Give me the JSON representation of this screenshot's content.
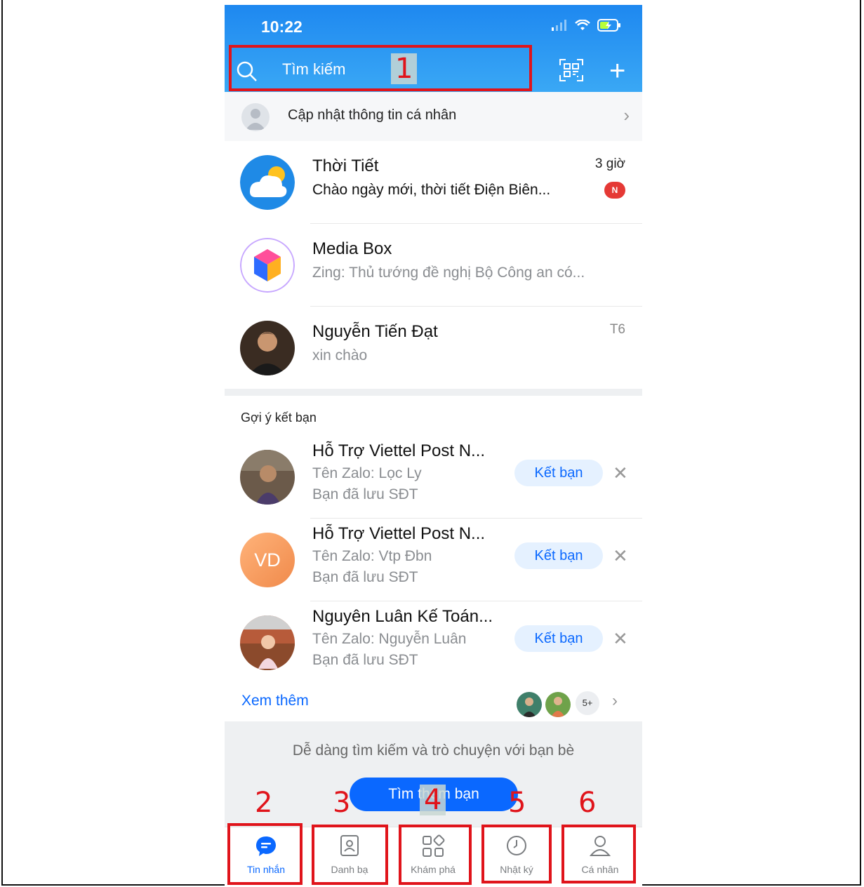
{
  "status_bar": {
    "time": "10:22"
  },
  "search": {
    "placeholder": "Tìm kiếm"
  },
  "update_profile": {
    "label": "Cập nhật thông tin cá nhân"
  },
  "chats": [
    {
      "name": "Thời Tiết",
      "message": "Chào ngày mới, thời tiết Điện Biên...",
      "time": "3 giờ",
      "badge": "N"
    },
    {
      "name": "Media Box",
      "message": "Zing: Thủ tướng đề nghị Bộ Công an có..."
    },
    {
      "name": "Nguyễn Tiến Đạt",
      "message": "xin chào",
      "time": "T6"
    }
  ],
  "suggestions": {
    "title": "Gợi ý kết bạn",
    "items": [
      {
        "name": "Hỗ Trợ Viettel Post N...",
        "zalo_name": "Tên Zalo: Lọc Ly",
        "note": "Bạn đã lưu SĐT",
        "button": "Kết bạn"
      },
      {
        "name": "Hỗ Trợ Viettel Post N...",
        "zalo_name": "Tên Zalo: Vtp Đbn",
        "note": "Bạn đã lưu SĐT",
        "button": "Kết bạn",
        "initials": "VD"
      },
      {
        "name": "Nguyên Luân Kế Toán...",
        "zalo_name": "Tên Zalo: Nguyễn Luân",
        "note": "Bạn đã lưu SĐT",
        "button": "Kết bạn"
      }
    ],
    "see_more": "Xem thêm",
    "more_count": "5+"
  },
  "find_friends": {
    "text": "Dễ dàng tìm kiếm và trò chuyện với bạn bè",
    "button": "Tìm thêm bạn"
  },
  "bottom_nav": [
    {
      "label": "Tin nhắn",
      "icon": "chat-bubble-icon",
      "active": true
    },
    {
      "label": "Danh bạ",
      "icon": "contacts-icon"
    },
    {
      "label": "Khám phá",
      "icon": "grid-icon"
    },
    {
      "label": "Nhật ký",
      "icon": "clock-icon"
    },
    {
      "label": "Cá nhân",
      "icon": "person-icon"
    }
  ],
  "annotations": [
    "1",
    "2",
    "3",
    "4",
    "5",
    "6"
  ],
  "colors": {
    "header": "#1e88f0",
    "accent": "#0a68ff",
    "annotation": "#e0141b"
  }
}
